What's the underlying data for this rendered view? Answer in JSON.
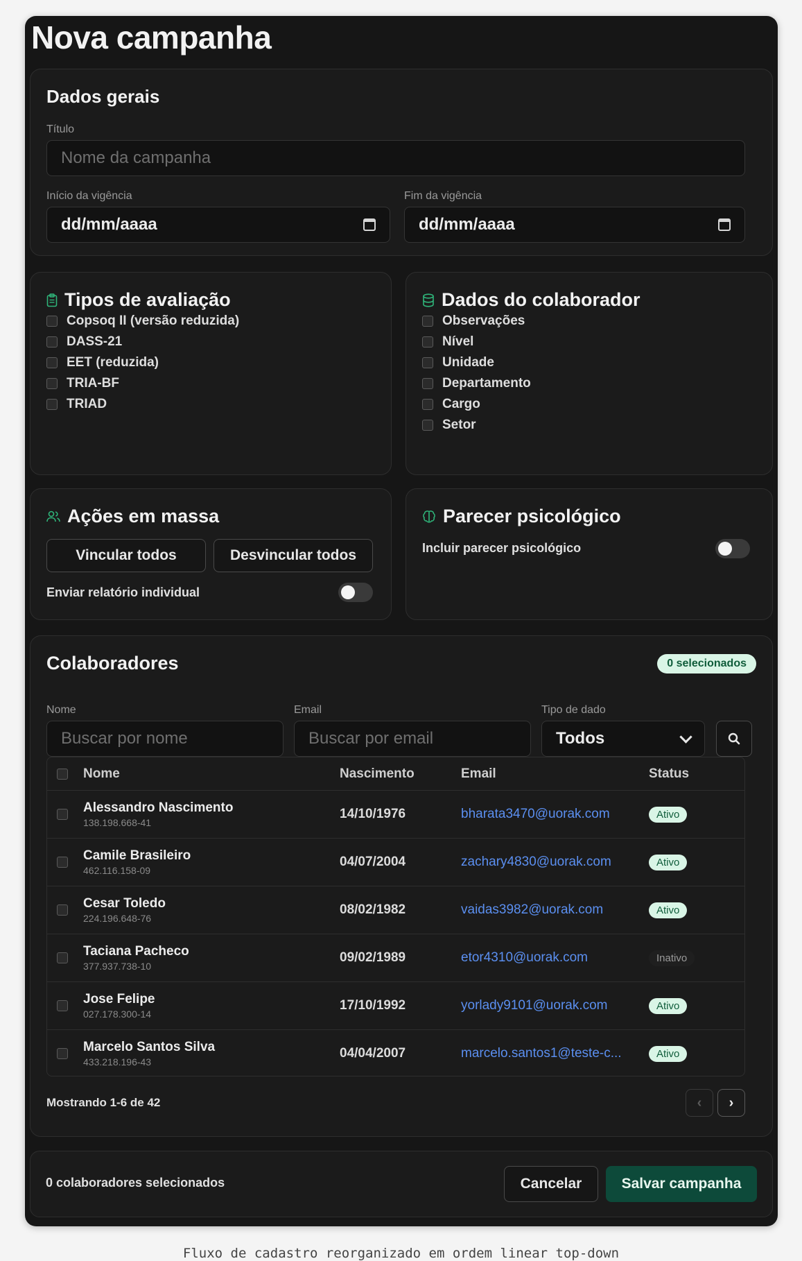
{
  "page": {
    "title": "Nova campanha"
  },
  "dados_gerais": {
    "title": "Dados gerais",
    "titulo_label": "Título",
    "titulo_placeholder": "Nome da campanha",
    "inicio_label": "Início da vigência",
    "inicio_value": "dd/mm/aaaa",
    "fim_label": "Fim da vigência",
    "fim_value": "dd/mm/aaaa"
  },
  "tipos_avaliacao": {
    "title": "Tipos de avaliação",
    "icon": "clipboard-icon",
    "items": [
      "Copsoq II (versão reduzida)",
      "DASS-21",
      "EET (reduzida)",
      "TRIA-BF",
      "TRIAD"
    ]
  },
  "dados_colaborador": {
    "title": "Dados do colaborador",
    "icon": "database-icon",
    "items": [
      "Observações",
      "Nível",
      "Unidade",
      "Departamento",
      "Cargo",
      "Setor"
    ]
  },
  "acoes_massa": {
    "title": "Ações em massa",
    "icon": "users-icon",
    "vincular_label": "Vincular todos",
    "desvincular_label": "Desvincular todos",
    "relatorio_label": "Enviar relatório individual",
    "relatorio_on": false
  },
  "parecer": {
    "title": "Parecer psicológico",
    "icon": "brain-icon",
    "incluir_label": "Incluir parecer psicológico",
    "incluir_on": false
  },
  "colaboradores": {
    "title": "Colaboradores",
    "selected_badge": "0 selecionados",
    "filters": {
      "nome_label": "Nome",
      "nome_placeholder": "Buscar por nome",
      "email_label": "Email",
      "email_placeholder": "Buscar por email",
      "tipo_label": "Tipo de dado",
      "tipo_value": "Todos"
    },
    "columns": [
      "Nome",
      "Nascimento",
      "Email",
      "Status"
    ],
    "rows": [
      {
        "name": "Alessandro Nascimento",
        "cpf": "138.198.668-41",
        "birth": "14/10/1976",
        "email": "bharata3470@uorak.com",
        "status": "Ativo",
        "active": true
      },
      {
        "name": "Camile Brasileiro",
        "cpf": "462.116.158-09",
        "birth": "04/07/2004",
        "email": "zachary4830@uorak.com",
        "status": "Ativo",
        "active": true
      },
      {
        "name": "Cesar Toledo",
        "cpf": "224.196.648-76",
        "birth": "08/02/1982",
        "email": "vaidas3982@uorak.com",
        "status": "Ativo",
        "active": true
      },
      {
        "name": "Taciana Pacheco",
        "cpf": "377.937.738-10",
        "birth": "09/02/1989",
        "email": "etor4310@uorak.com",
        "status": "Inativo",
        "active": false
      },
      {
        "name": "Jose Felipe",
        "cpf": "027.178.300-14",
        "birth": "17/10/1992",
        "email": "yorlady9101@uorak.com",
        "status": "Ativo",
        "active": true
      },
      {
        "name": "Marcelo Santos Silva",
        "cpf": "433.218.196-43",
        "birth": "04/04/2007",
        "email": "marcelo.santos1@teste-c...",
        "status": "Ativo",
        "active": true
      }
    ],
    "pagination_text": "Mostrando 1-6 de 42",
    "prev_icon": "‹",
    "next_icon": "›"
  },
  "footer": {
    "selected_text": "0 colaboradores selecionados",
    "cancel_label": "Cancelar",
    "save_label": "Salvar campanha"
  },
  "caption": "Fluxo de cadastro reorganizado em ordem linear top-down",
  "colors": {
    "accent": "#0d4a3a",
    "link": "#5b8ff0",
    "badge_bg": "#d9f5e6",
    "icon_green": "#2fb57a"
  }
}
